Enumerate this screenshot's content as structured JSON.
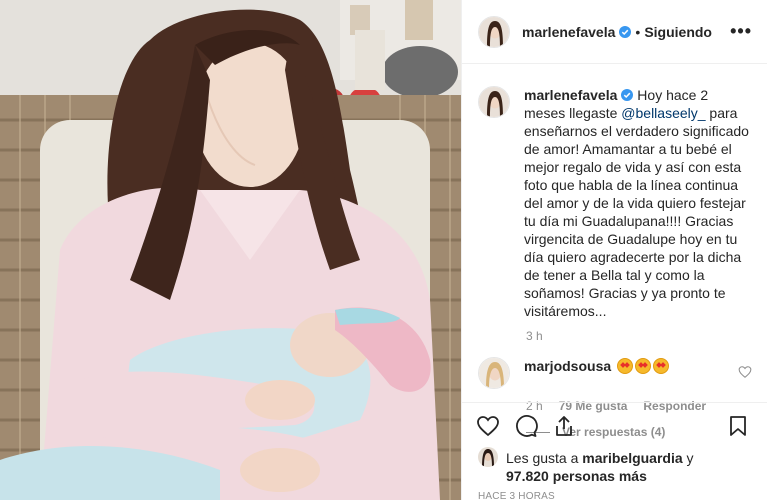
{
  "header": {
    "username": "marlenefavela",
    "separator": "•",
    "follow_state": "Siguiendo",
    "more_label": "•••"
  },
  "caption": {
    "username": "marlenefavela",
    "text_before": " Hoy hace 2 meses llegaste ",
    "mention": "@bellaseely_",
    "text_after": " para enseñarnos el verdadero significado de amor! Amamantar a tu bebé el mejor regalo de vida y así con esta foto que habla de la línea continua del amor y de la vida quiero festejar tu día mi Guadalupana!!!! Gracias virgencita de Guadalupe hoy en tu día quiero agradecerte por la dicha de tener a Bella tal y como la soñamos! Gracias y ya pronto te visitáremos...",
    "time": "3 h"
  },
  "comment": {
    "username": "marjodsousa",
    "emoji_count": 3,
    "emoji_name": "star-struck-emoji",
    "time": "2 h",
    "likes": "79 Me gusta",
    "reply_label": "Responder",
    "view_replies": "Ver respuestas (4)"
  },
  "likes": {
    "prefix": "Les gusta a ",
    "user": "maribelguardia",
    "conj": " y",
    "count": "97.820 personas más"
  },
  "timestamp": "HACE 3 HORAS",
  "colors": {
    "text": "#262626",
    "muted": "#8e8e8e",
    "verified": "#3897f0",
    "mention": "#00376b",
    "border": "#efefef"
  },
  "icons": [
    "heart-icon",
    "comment-icon",
    "share-icon",
    "bookmark-icon",
    "more-icon",
    "verified-badge-icon"
  ]
}
